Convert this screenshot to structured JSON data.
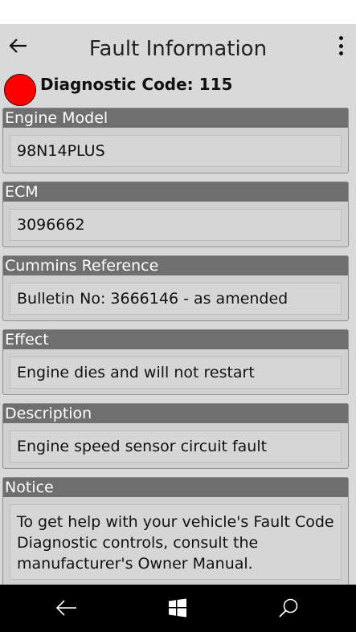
{
  "header": {
    "title": "Fault Information"
  },
  "diagnostic": {
    "label": "Diagnostic Code: 115",
    "status_color": "#ff0000"
  },
  "sections": [
    {
      "title": "Engine Model",
      "value": "98N14PLUS"
    },
    {
      "title": "ECM",
      "value": "3096662"
    },
    {
      "title": "Cummins Reference",
      "value": "Bulletin No: 3666146 - as amended"
    },
    {
      "title": "Effect",
      "value": "Engine dies and will not restart"
    },
    {
      "title": "Description",
      "value": "Engine speed sensor circuit fault"
    },
    {
      "title": "Notice",
      "value": "To get help with your vehicle's Fault Code Diagnostic controls, consult the manufacturer's Owner Manual."
    }
  ],
  "navbar": {
    "icons": [
      "back-icon",
      "windows-start-icon",
      "search-icon"
    ]
  },
  "colors": {
    "section_header_bg": "#6f6f6f",
    "app_bg": "#d9d9d9",
    "navbar_bg": "#000000"
  }
}
